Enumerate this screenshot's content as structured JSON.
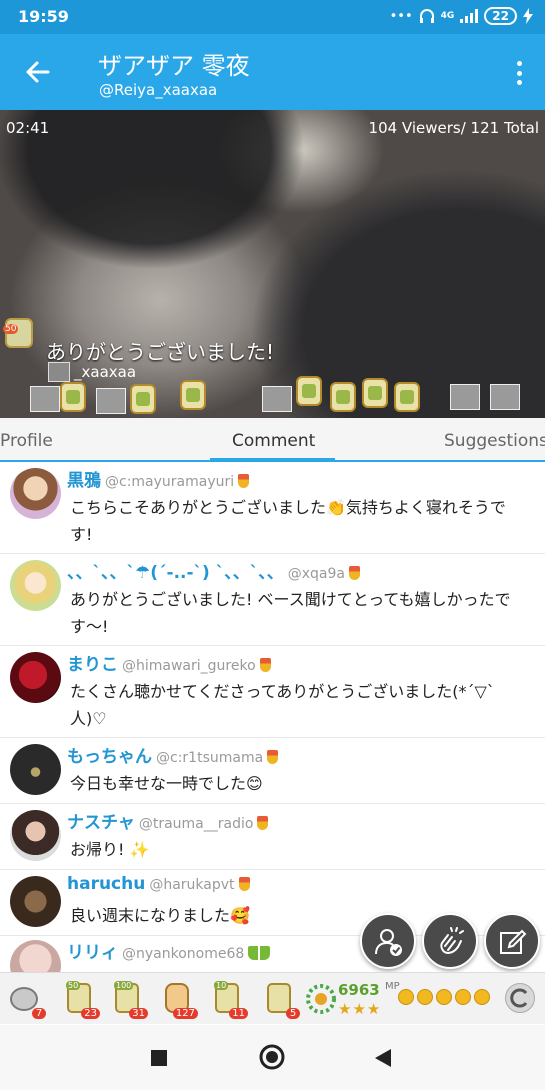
{
  "status": {
    "time": "19:59",
    "network": "4G",
    "battery": "22"
  },
  "header": {
    "title": "ザアザア 零夜",
    "subtitle": "@Reiya_xaaxaa"
  },
  "video": {
    "timer": "02:41",
    "viewers": "104 Viewers/ 121 Total",
    "caption": "ありがとうございました!",
    "caption_user": "_xaaxaa",
    "gift_badge": "50"
  },
  "tabs": [
    "Profile",
    "Comment",
    "Suggestions"
  ],
  "comments": [
    {
      "name": "黒鴉",
      "handle": "@c:mayuramayuri",
      "text": "こちらこそありがとうございました👏気持ちよく寝れそうです!"
    },
    {
      "name": "、、`、、`☂(´-..-`) `、、`、、",
      "handle": "@xqa9a",
      "text": "ありがとうございました! ベース聞けてとっても嬉しかったです〜!"
    },
    {
      "name": "まりこ",
      "handle": "@himawari_gureko",
      "text": "たくさん聴かせてくださってありがとうございました(*´▽`人)♡"
    },
    {
      "name": "もっちゃん",
      "handle": "@c:r1tsumama",
      "text": "今日も幸せな一時でした😊"
    },
    {
      "name": "ナスチャ",
      "handle": "@trauma__radio",
      "text": "お帰り! ✨"
    },
    {
      "name": "haruchu",
      "handle": "@harukapvt",
      "text": "良い週末になりました🥰"
    },
    {
      "name": "リリィ",
      "handle": "@nyankonome68",
      "text": ""
    }
  ],
  "gifts": [
    {
      "count": "7",
      "label": ""
    },
    {
      "count": "23",
      "label": "50"
    },
    {
      "count": "31",
      "label": "100"
    },
    {
      "count": "127",
      "label": ""
    },
    {
      "count": "11",
      "label": "10"
    },
    {
      "count": "5",
      "label": ""
    }
  ],
  "mp": {
    "value": "6963",
    "unit": "MP",
    "stars": "★★★"
  },
  "colors": {
    "accent": "#2aa7e8",
    "name": "#2196d3",
    "fab": "#4a4a4a"
  }
}
